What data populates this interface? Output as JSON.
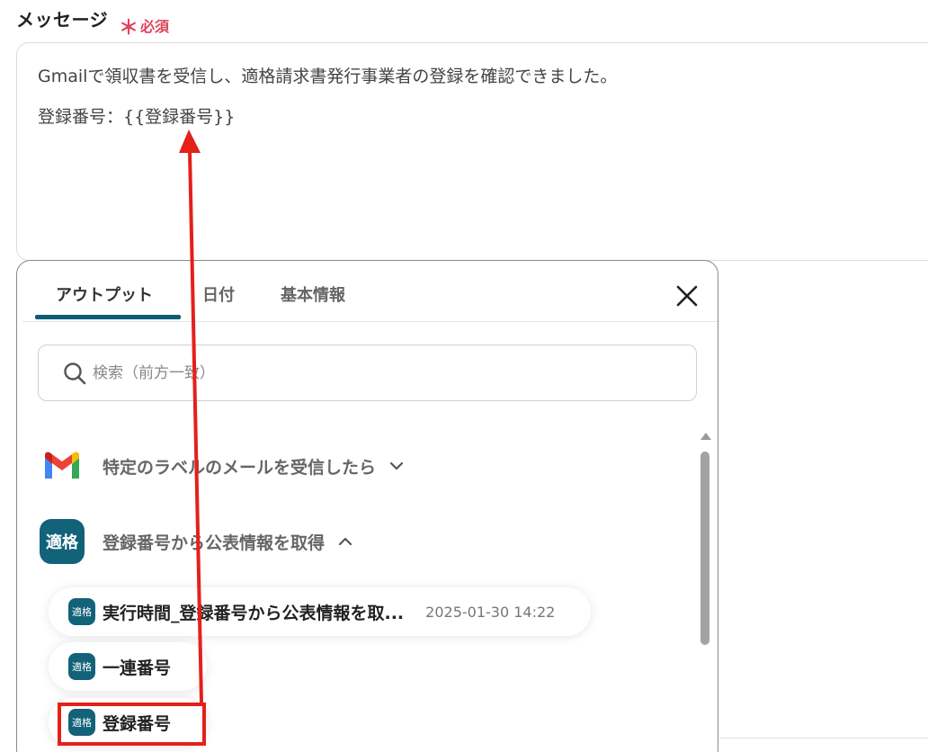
{
  "field": {
    "label": "メッセージ",
    "required_mark": "＊",
    "required_text": "必須"
  },
  "message": {
    "line1": "Gmailで領収書を受信し、適格請求書発行事業者の登録を確認できました。",
    "line2": "登録番号：{{登録番号}}"
  },
  "panel": {
    "tabs": [
      {
        "label": "アウトプット",
        "active": true
      },
      {
        "label": "日付",
        "active": false
      },
      {
        "label": "基本情報",
        "active": false
      }
    ],
    "search_placeholder": "検索（前方一致）",
    "groups": [
      {
        "title": "特定のラベルのメールを受信したら",
        "icon": "gmail-icon",
        "expanded": false
      },
      {
        "title": "登録番号から公表情報を取得",
        "icon_text": "適格",
        "expanded": true
      }
    ],
    "items": [
      {
        "badge": "適格",
        "label": "実行時間_登録番号から公表情報を取...",
        "value": "2025-01-30 14:22"
      },
      {
        "badge": "適格",
        "label": "一連番号",
        "value": ""
      },
      {
        "badge": "適格",
        "label": "登録番号",
        "value": ""
      }
    ]
  },
  "colors": {
    "accent": "#12627a",
    "required": "#e0455a",
    "annotation": "#e3201b"
  }
}
